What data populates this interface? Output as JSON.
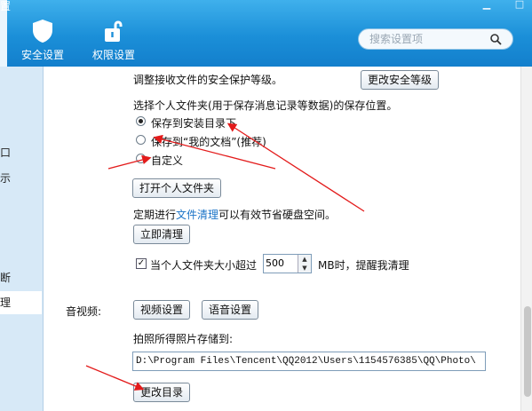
{
  "window": {
    "title_fragment": "置",
    "maximize_glyph": "□"
  },
  "toolbar": {
    "security_label": "安全设置",
    "permission_label": "权限设置",
    "search_placeholder": "搜索设置项"
  },
  "sidebar": {
    "items": [
      {
        "label": "口"
      },
      {
        "label": "示"
      },
      {
        "label": "断"
      },
      {
        "label": "理"
      }
    ]
  },
  "security": {
    "adjust_text": "调整接收文件的安全保护等级。",
    "change_level_button": "更改安全等级"
  },
  "folder": {
    "select_text": "选择个人文件夹(用于保存消息记录等数据)的保存位置。",
    "options": [
      {
        "label": "保存到安装目录下",
        "selected": true
      },
      {
        "label": "保存到“我的文档”(推荐)",
        "selected": false
      },
      {
        "label": "自定义",
        "selected": false
      }
    ],
    "open_button": "打开个人文件夹"
  },
  "cleanup": {
    "text_before": "定期进行",
    "link": "文件清理",
    "text_after": "可以有效节省硬盘空间。",
    "clean_now_button": "立即清理",
    "warn_checked": true,
    "warn_label": "当个人文件夹大小超过",
    "size_value": "500",
    "warn_suffix": "MB时，提醒我清理"
  },
  "av": {
    "label": "音视频:",
    "video_button": "视频设置",
    "voice_button": "语音设置"
  },
  "photo": {
    "label": "拍照所得照片存储到:",
    "path": "D:\\Program Files\\Tencent\\QQ2012\\Users\\1154576385\\QQ\\Photo\\",
    "change_dir_button": "更改目录"
  },
  "colors": {
    "toolbar_blue": "#1b8fd8",
    "sidebar_bg": "#d7e9f7",
    "annotation_red": "#e31b1b",
    "link_blue": "#1a73c7"
  }
}
